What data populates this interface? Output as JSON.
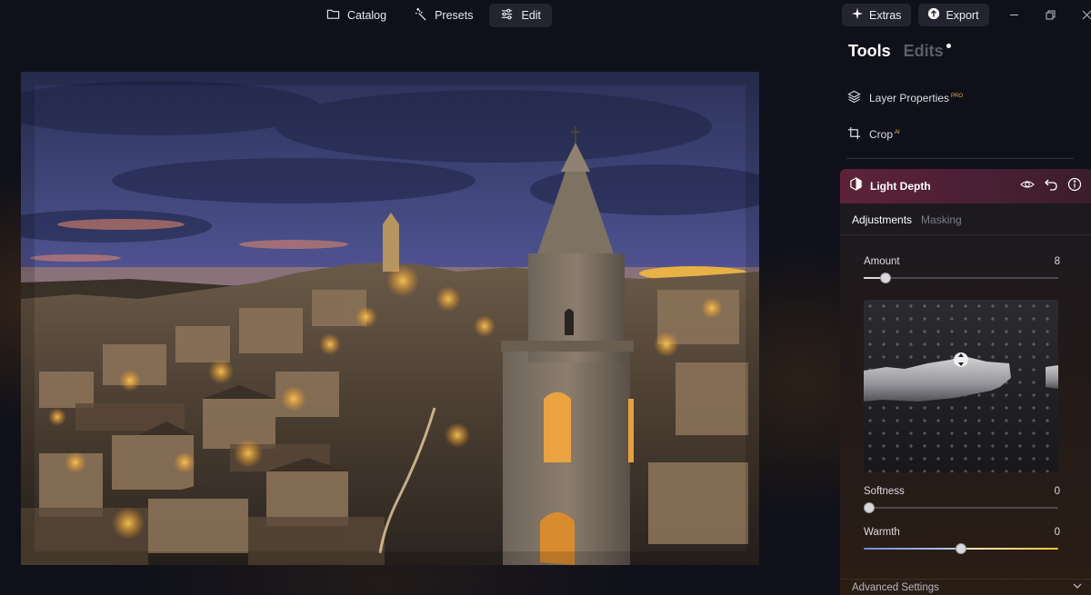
{
  "nav": {
    "catalog": "Catalog",
    "presets": "Presets",
    "edit": "Edit",
    "active": "edit"
  },
  "window": {
    "extras": "Extras",
    "export": "Export",
    "minimize_icon": "minimize-icon",
    "restore_icon": "restore-icon",
    "close_icon": "close-icon"
  },
  "panel": {
    "tab_tools": "Tools",
    "tab_edits": "Edits",
    "tools": [
      {
        "label": "Layer Properties",
        "badge": "PRO",
        "icon": "layers-icon"
      },
      {
        "label": "Crop",
        "badge": "AI",
        "icon": "crop-icon"
      }
    ],
    "light_depth": {
      "title": "Light Depth",
      "subtabs": [
        "Adjustments",
        "Masking"
      ],
      "active_subtab": "Adjustments",
      "amount_label": "Amount",
      "amount_value": "8",
      "amount_fraction": 0.11,
      "softness_label": "Softness",
      "softness_value": "0",
      "softness_fraction": 0.0,
      "warmth_label": "Warmth",
      "warmth_value": "0",
      "warmth_fraction": 0.5,
      "advanced": "Advanced Settings"
    }
  },
  "colors": {
    "accent_header": "#5e2238",
    "badge": "#e4b34a",
    "warmth_cool": "#6d8de0",
    "warmth_warm": "#f0c43a"
  }
}
